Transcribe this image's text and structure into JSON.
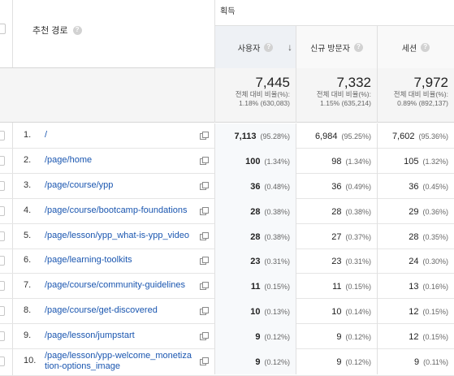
{
  "header": {
    "group_label": "획득",
    "dimension_label": "추천 경로",
    "columns": [
      {
        "label": "사용자",
        "sorted": true
      },
      {
        "label": "신규 방문자"
      },
      {
        "label": "세션"
      }
    ]
  },
  "totals": [
    {
      "value": "7,445",
      "caption": "전체 대비 비율(%):",
      "detail": "1.18% (630,083)"
    },
    {
      "value": "7,332",
      "caption": "전체 대비 비율(%):",
      "detail": "1.15% (635,214)"
    },
    {
      "value": "7,972",
      "caption": "전체 대비 비율(%):",
      "detail": "0.89% (892,137)"
    }
  ],
  "rows": [
    {
      "index": "1.",
      "path": "/",
      "users": "7,113",
      "users_pct": "(95.28%)",
      "new": "6,984",
      "new_pct": "(95.25%)",
      "sessions": "7,602",
      "sessions_pct": "(95.36%)"
    },
    {
      "index": "2.",
      "path": "/page/home",
      "users": "100",
      "users_pct": "(1.34%)",
      "new": "98",
      "new_pct": "(1.34%)",
      "sessions": "105",
      "sessions_pct": "(1.32%)"
    },
    {
      "index": "3.",
      "path": "/page/course/ypp",
      "users": "36",
      "users_pct": "(0.48%)",
      "new": "36",
      "new_pct": "(0.49%)",
      "sessions": "36",
      "sessions_pct": "(0.45%)"
    },
    {
      "index": "4.",
      "path": "/page/course/bootcamp-foundations",
      "users": "28",
      "users_pct": "(0.38%)",
      "new": "28",
      "new_pct": "(0.38%)",
      "sessions": "29",
      "sessions_pct": "(0.36%)"
    },
    {
      "index": "5.",
      "path": "/page/lesson/ypp_what-is-ypp_video",
      "users": "28",
      "users_pct": "(0.38%)",
      "new": "27",
      "new_pct": "(0.37%)",
      "sessions": "28",
      "sessions_pct": "(0.35%)"
    },
    {
      "index": "6.",
      "path": "/page/learning-toolkits",
      "users": "23",
      "users_pct": "(0.31%)",
      "new": "23",
      "new_pct": "(0.31%)",
      "sessions": "24",
      "sessions_pct": "(0.30%)"
    },
    {
      "index": "7.",
      "path": "/page/course/community-guidelines",
      "users": "11",
      "users_pct": "(0.15%)",
      "new": "11",
      "new_pct": "(0.15%)",
      "sessions": "13",
      "sessions_pct": "(0.16%)"
    },
    {
      "index": "8.",
      "path": "/page/course/get-discovered",
      "users": "10",
      "users_pct": "(0.13%)",
      "new": "10",
      "new_pct": "(0.14%)",
      "sessions": "12",
      "sessions_pct": "(0.15%)"
    },
    {
      "index": "9.",
      "path": "/page/lesson/jumpstart",
      "users": "9",
      "users_pct": "(0.12%)",
      "new": "9",
      "new_pct": "(0.12%)",
      "sessions": "12",
      "sessions_pct": "(0.15%)"
    },
    {
      "index": "10.",
      "path": "/page/lesson/ypp-welcome_monetiza tion-options_image",
      "path_line1": "/page/lesson/ypp-welcome_monetiza",
      "path_line2": "tion-options_image",
      "users": "9",
      "users_pct": "(0.12%)",
      "new": "9",
      "new_pct": "(0.12%)",
      "sessions": "9",
      "sessions_pct": "(0.11%)"
    }
  ],
  "icons": {
    "help": "help-icon",
    "external": "open-in-new-icon",
    "sort": "sort-descending-icon"
  }
}
